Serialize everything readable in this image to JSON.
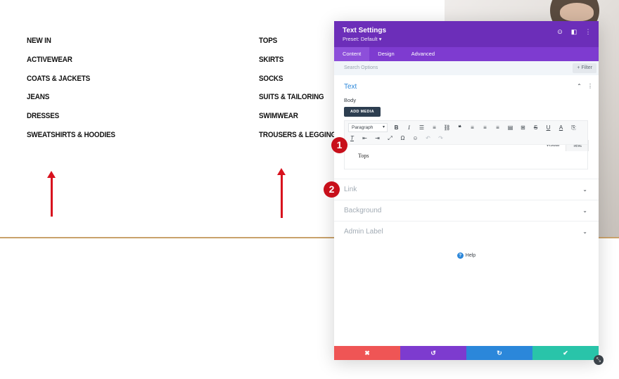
{
  "page": {
    "menu_left": [
      "NEW IN",
      "ACTIVEWEAR",
      "COATS & JACKETS",
      "JEANS",
      "DRESSES",
      "SWEATSHIRTS & HOODIES"
    ],
    "menu_right": [
      "TOPS",
      "SKIRTS",
      "SOCKS",
      "SUITS & TAILORING",
      "SWIMWEAR",
      "TROUSERS & LEGGINGS"
    ]
  },
  "modal": {
    "title": "Text Settings",
    "preset": "Preset: Default ▾",
    "header_icons": [
      "target-icon",
      "split-view-icon",
      "more-vertical-icon"
    ],
    "tabs": [
      "Content",
      "Design",
      "Advanced"
    ],
    "active_tab": "Content",
    "search": {
      "placeholder": "Search Options",
      "filter_label": "+ Filter"
    },
    "text_section": {
      "title": "Text",
      "body_label": "Body",
      "add_media_label": "ADD MEDIA",
      "modes": [
        "Visual",
        "Text"
      ],
      "active_mode": "Text",
      "paragraph_select": "Paragraph",
      "content": "Tops"
    },
    "sections": [
      "Link",
      "Background",
      "Admin Label"
    ],
    "help_label": "Help",
    "footer": {
      "cancel": "✖",
      "undo": "↺",
      "redo": "↻",
      "save": "✔"
    }
  },
  "annotations": {
    "badge_1": "1",
    "badge_2": "2"
  },
  "colors": {
    "header_purple": "#6c2eb9",
    "tabs_purple": "#7e3bd0",
    "link_blue": "#2b87da",
    "cancel_red": "#ef5555",
    "save_green": "#29c4a9",
    "annotation_red": "#c8101b",
    "divider_gold": "#c9a26b"
  }
}
